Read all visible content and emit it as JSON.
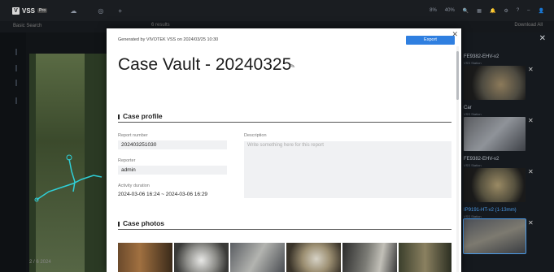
{
  "app": {
    "logo_text": "VSS",
    "tab_badge": "Pro",
    "topbar_stats": [
      "8%",
      "40%"
    ]
  },
  "subbar": {
    "left": "Basic Search",
    "mid": "6 results",
    "right": "Download All"
  },
  "background": {
    "footer_left": "2 / 6  2024",
    "cameras": [
      {
        "name": "FE9382-EHV-v2",
        "sub": "VSS Station"
      },
      {
        "name": "Car",
        "sub": "VSS Station"
      },
      {
        "name": "FE9382-EHV-v2",
        "sub": "VSS Station"
      },
      {
        "name": "IP9191-HT-v2 (1-13mm)",
        "sub": "VSS Station"
      }
    ]
  },
  "modal": {
    "generated_by": "Generated by VIVOTEK VSS on 2024/03/25 10:30",
    "export_label": "Export",
    "title": "Case Vault - 20240325",
    "case_profile": {
      "heading": "Case profile",
      "report_number_label": "Report number",
      "report_number": "202403251030",
      "reporter_label": "Reporter",
      "reporter": "admin",
      "activity_label": "Activity duration",
      "activity": "2024-03-06 16:24 ~ 2024-03-06 16:29",
      "description_label": "Description",
      "description_placeholder": "Write something here for this report"
    },
    "case_photos": {
      "heading": "Case photos"
    }
  },
  "colors": {
    "accent": "#2f7fe0",
    "modal_bg": "#ffffff",
    "app_bg": "#111417"
  }
}
